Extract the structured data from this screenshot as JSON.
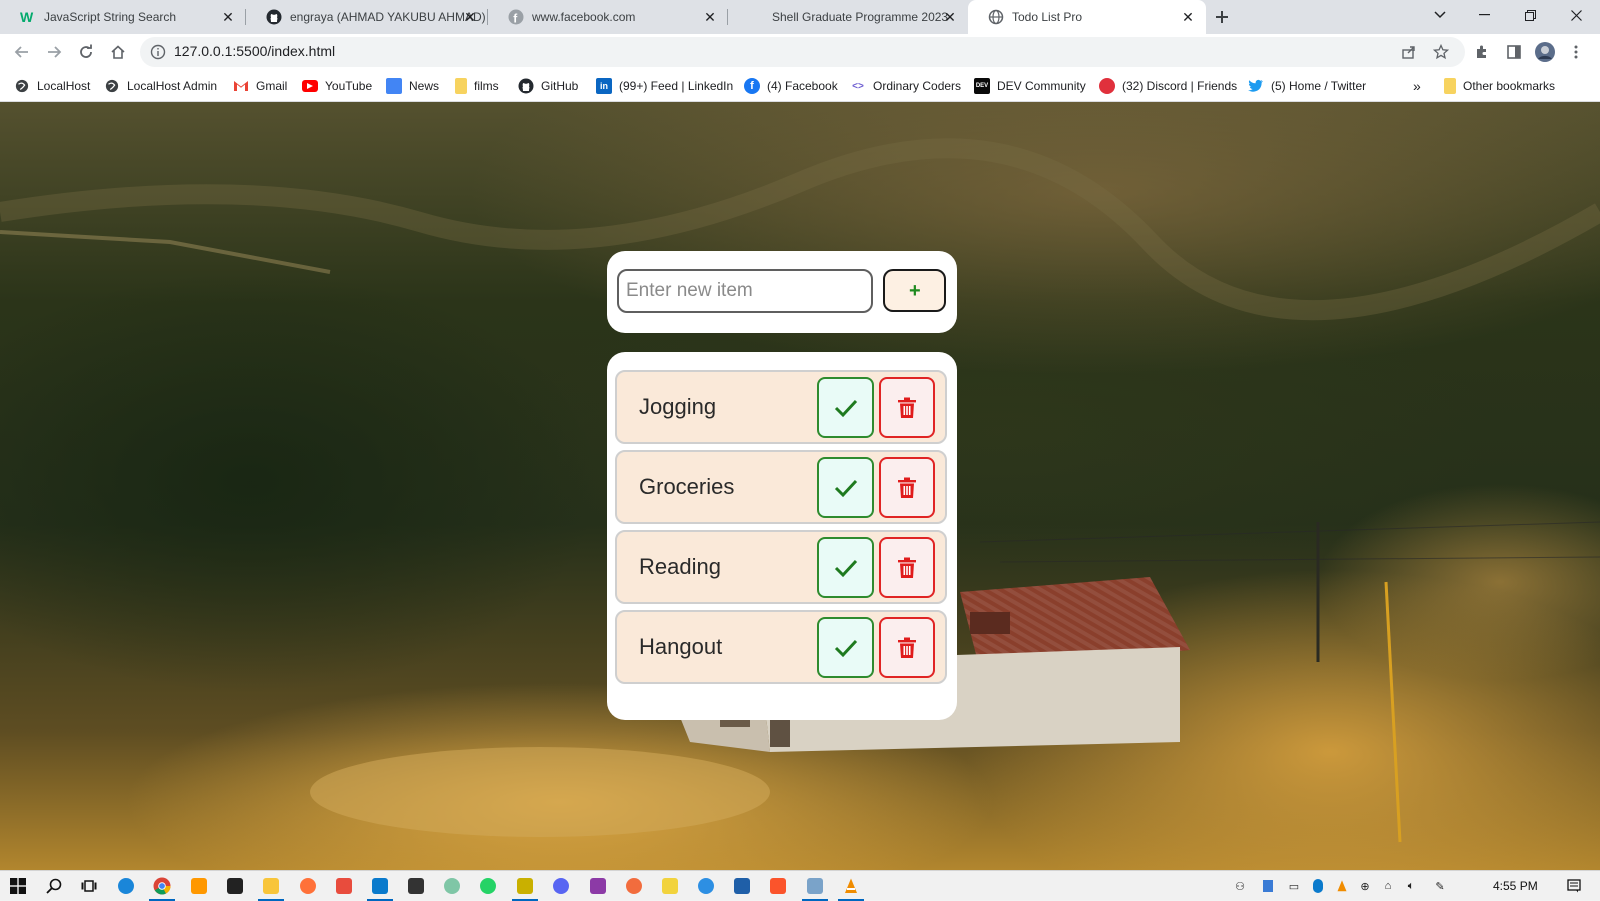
{
  "browser": {
    "tabs": [
      {
        "title": "JavaScript String Search",
        "icon": "w3schools-icon"
      },
      {
        "title": "engraya (AHMAD YAKUBU AHMAD)",
        "icon": "github-icon"
      },
      {
        "title": "www.facebook.com",
        "icon": "facebook-icon"
      },
      {
        "title": "Shell Graduate Programme 2023",
        "icon": "shell-icon"
      },
      {
        "title": "Todo List Pro",
        "icon": "globe-icon",
        "active": true
      }
    ],
    "url": "127.0.0.1:5500/index.html",
    "bookmarks": [
      {
        "label": "LocalHost",
        "icon": "globe-icon"
      },
      {
        "label": "LocalHost Admin",
        "icon": "globe-icon"
      },
      {
        "label": "Gmail",
        "icon": "gmail-icon"
      },
      {
        "label": "YouTube",
        "icon": "youtube-icon"
      },
      {
        "label": "News",
        "icon": "news-icon"
      },
      {
        "label": "films",
        "icon": "folder-icon"
      },
      {
        "label": "GitHub",
        "icon": "github-icon"
      },
      {
        "label": "(99+) Feed | LinkedIn",
        "icon": "linkedin-icon"
      },
      {
        "label": "(4) Facebook",
        "icon": "facebook-icon"
      },
      {
        "label": "Ordinary Coders",
        "icon": "code-icon"
      },
      {
        "label": "DEV Community",
        "icon": "dev-icon"
      },
      {
        "label": "(32) Discord | Friends",
        "icon": "discord-icon"
      },
      {
        "label": "(5) Home / Twitter",
        "icon": "twitter-icon"
      }
    ],
    "other_bookmarks": "Other bookmarks",
    "more_bookmarks": "»"
  },
  "todo": {
    "input_placeholder": "Enter new item",
    "add_label": "+",
    "items": [
      "Jogging",
      "Groceries",
      "Reading",
      "Hangout"
    ]
  },
  "taskbar": {
    "time": "4:55 PM"
  },
  "colors": {
    "check_green": "#2e8b2e",
    "delete_red": "#e02424",
    "row_bg": "#fae9d9"
  }
}
